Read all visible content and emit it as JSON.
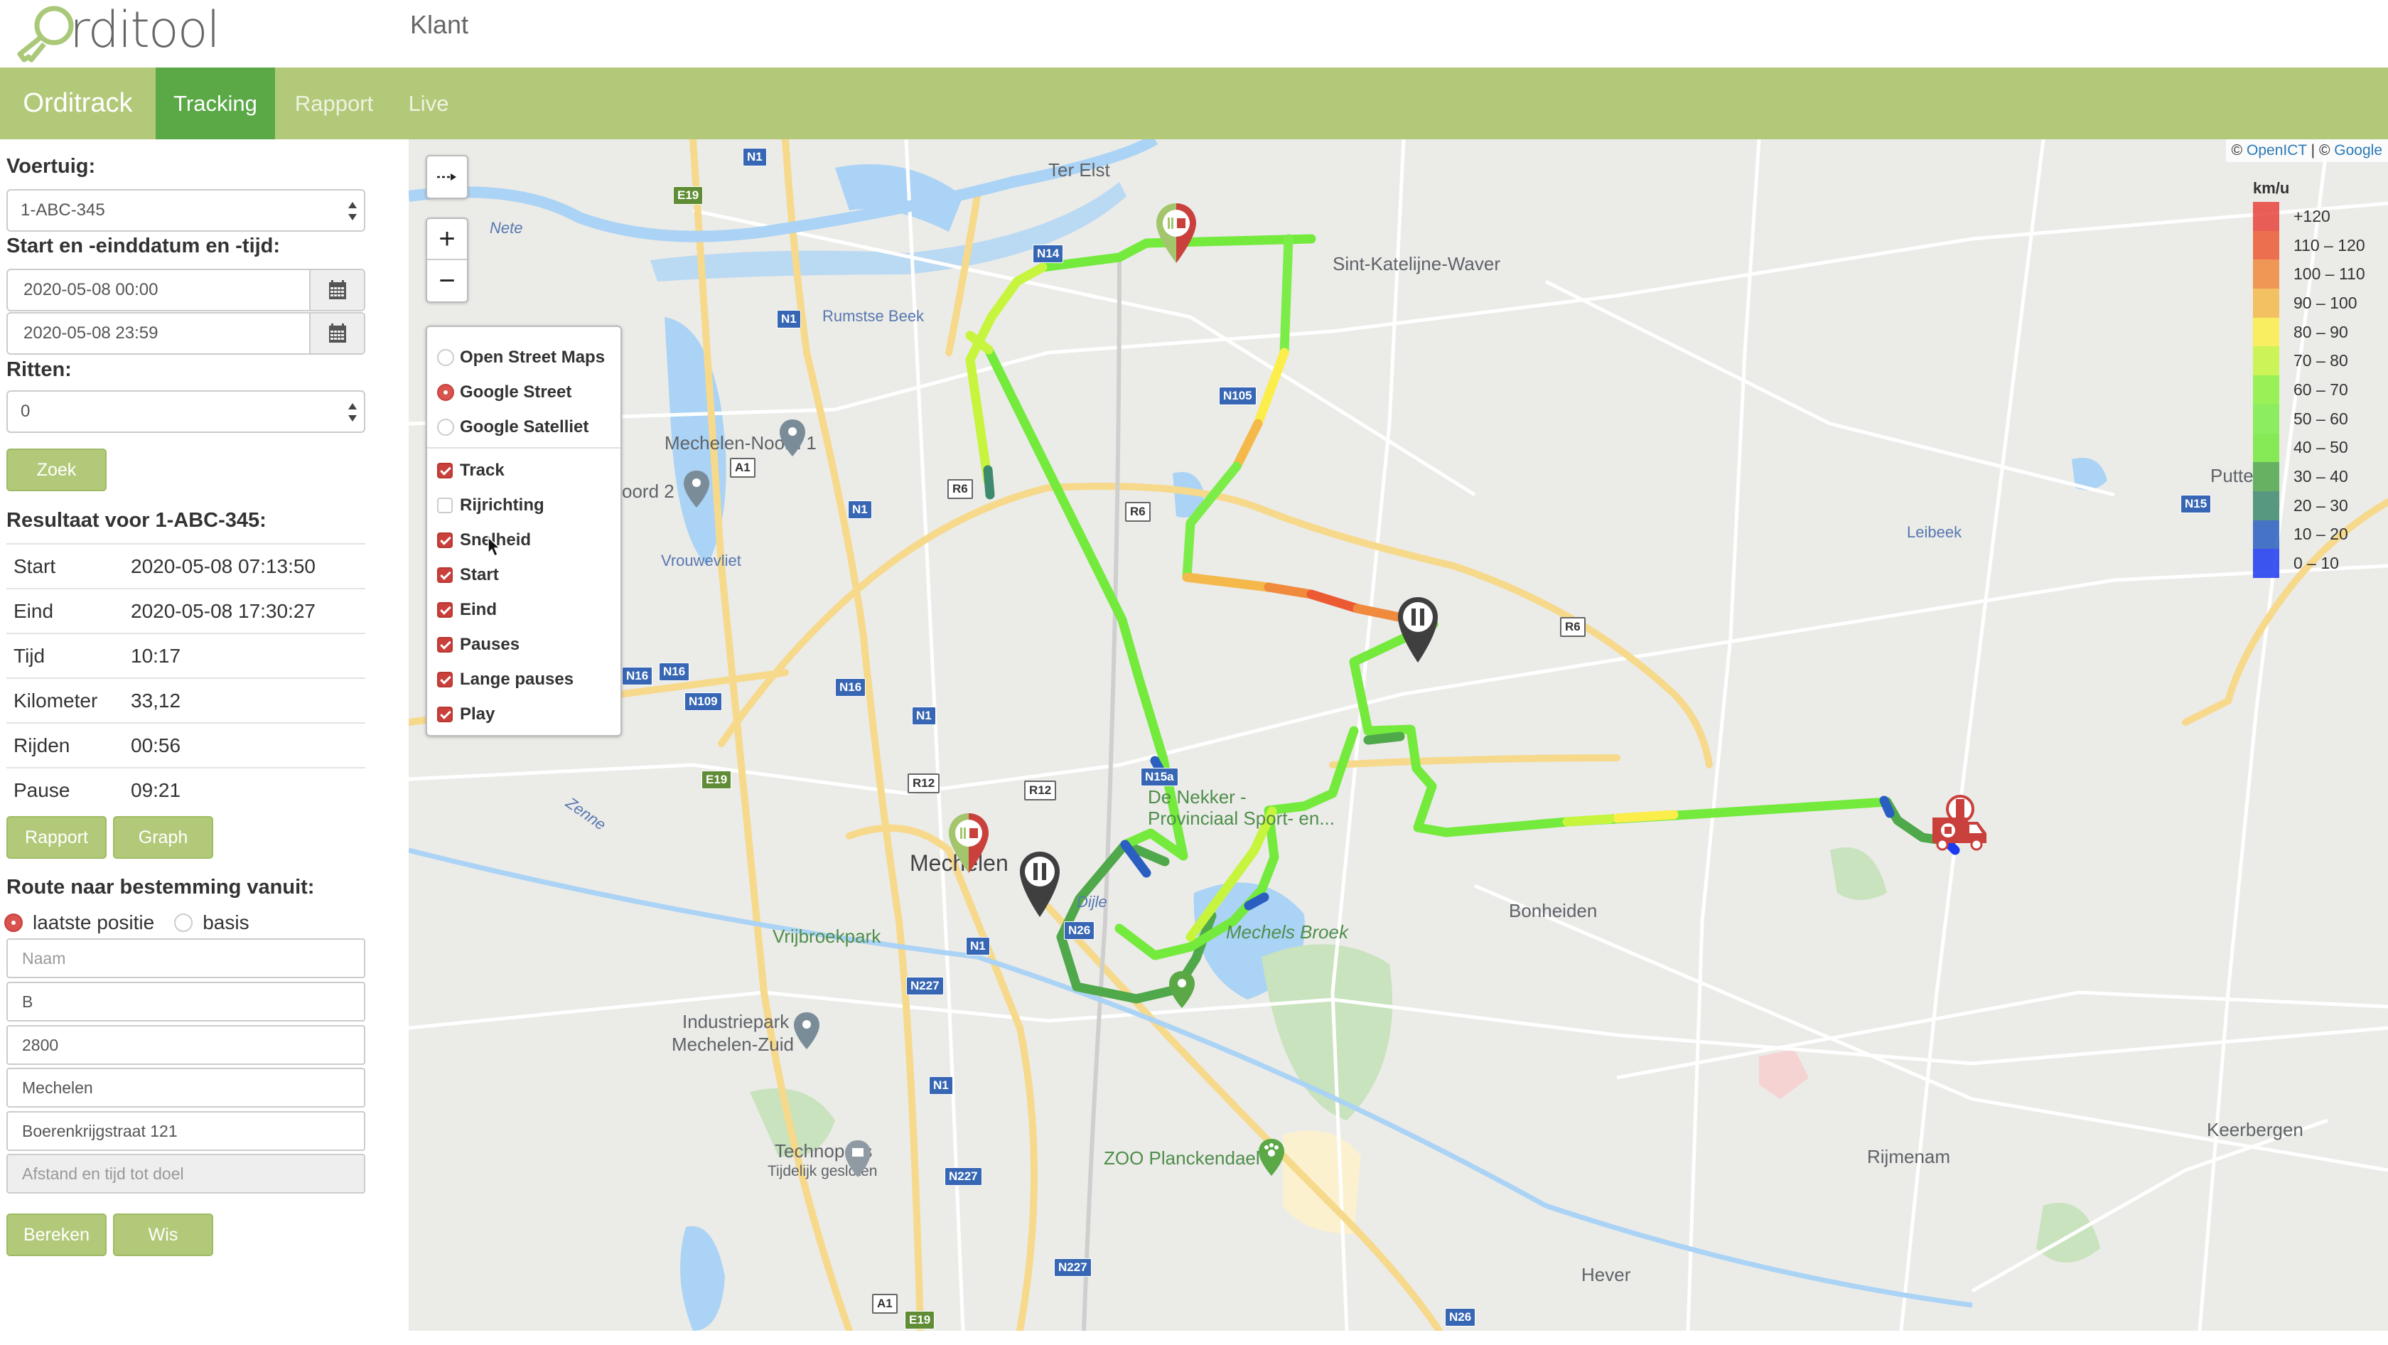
{
  "header": {
    "logo_text": "rditool",
    "client_label": "Klant"
  },
  "nav": {
    "brand": "Orditrack",
    "tabs": [
      {
        "label": "Tracking",
        "active": true
      },
      {
        "label": "Rapport",
        "active": false
      },
      {
        "label": "Live",
        "active": false
      }
    ]
  },
  "sidebar": {
    "vehicle_label": "Voertuig:",
    "vehicle_value": "1-ABC-345",
    "datetime_label": "Start en -einddatum en -tijd:",
    "start_datetime": "2020-05-08 00:00",
    "end_datetime": "2020-05-08 23:59",
    "trips_label": "Ritten:",
    "trips_value": "0",
    "search_button": "Zoek",
    "result_title": "Resultaat voor 1-ABC-345:",
    "results": [
      {
        "key": "Start",
        "value": "2020-05-08 07:13:50"
      },
      {
        "key": "Eind",
        "value": "2020-05-08 17:30:27"
      },
      {
        "key": "Tijd",
        "value": "10:17"
      },
      {
        "key": "Kilometer",
        "value": "33,12"
      },
      {
        "key": "Rijden",
        "value": "00:56"
      },
      {
        "key": "Pause",
        "value": "09:21"
      }
    ],
    "report_button": "Rapport",
    "graph_button": "Graph",
    "route_title": "Route naar bestemming vanuit:",
    "route_options": [
      {
        "label": "laatste positie",
        "selected": true
      },
      {
        "label": "basis",
        "selected": false
      }
    ],
    "name_placeholder": "Naam",
    "country_value": "B",
    "postcode_value": "2800",
    "city_value": "Mechelen",
    "street_value": "Boerenkrijgstraat 121",
    "distance_placeholder": "Afstand en tijd tot doel",
    "calc_button": "Bereken",
    "clear_button": "Wis"
  },
  "map": {
    "attribution_prefix": "©",
    "attribution_openict": "OpenICT",
    "attribution_sep": "| ©",
    "attribution_google": "Google",
    "controls": {
      "toggle_icon": "dashed-arrow-right-icon",
      "zoom_in": "+",
      "zoom_out": "−"
    },
    "base_layers": [
      {
        "label": "Open Street Maps",
        "selected": false
      },
      {
        "label": "Google Street",
        "selected": true
      },
      {
        "label": "Google Satelliet",
        "selected": false
      }
    ],
    "overlays": [
      {
        "label": "Track",
        "checked": true
      },
      {
        "label": "Rijrichting",
        "checked": false
      },
      {
        "label": "Snelheid",
        "checked": true
      },
      {
        "label": "Start",
        "checked": true
      },
      {
        "label": "Eind",
        "checked": true
      },
      {
        "label": "Pauses",
        "checked": true
      },
      {
        "label": "Lange pauses",
        "checked": true
      },
      {
        "label": "Play",
        "checked": true
      }
    ],
    "legend": {
      "title": "km/u",
      "ranges": [
        {
          "label": "+120",
          "color": "#e8453c"
        },
        {
          "label": "110 – 120",
          "color": "#ec5a34"
        },
        {
          "label": "100 – 110",
          "color": "#f08a3c"
        },
        {
          "label": "90 – 100",
          "color": "#f4b94a"
        },
        {
          "label": "80 – 90",
          "color": "#fbee4a"
        },
        {
          "label": "70 – 80",
          "color": "#c7f53e"
        },
        {
          "label": "60 – 70",
          "color": "#8af23c"
        },
        {
          "label": "50 – 60",
          "color": "#7ced48"
        },
        {
          "label": "40 – 50",
          "color": "#74ea3c"
        },
        {
          "label": "30 – 40",
          "color": "#4fa84a"
        },
        {
          "label": "20 – 30",
          "color": "#3d8a6e"
        },
        {
          "label": "10 – 20",
          "color": "#2a5ec0"
        },
        {
          "label": "0 – 10",
          "color": "#1d3af0"
        }
      ]
    },
    "place_labels": [
      {
        "text": "Ter Elst",
        "type": "town"
      },
      {
        "text": "Sint-Katelijne-Waver",
        "type": "town"
      },
      {
        "text": "Rumstse Beek",
        "type": "water"
      },
      {
        "text": "Mechelen-Noord 1",
        "type": "poi"
      },
      {
        "text": "oord 2",
        "type": "poi"
      },
      {
        "text": "Vrouwevliet",
        "type": "water"
      },
      {
        "text": "Leibeek",
        "type": "water"
      },
      {
        "text": "Putte",
        "type": "town"
      },
      {
        "text": "De Nekker -",
        "type": "park"
      },
      {
        "text": "Provinciaal Sport- en...",
        "type": "park"
      },
      {
        "text": "Mechelen",
        "type": "city"
      },
      {
        "text": "Vrijbroekpark",
        "type": "park"
      },
      {
        "text": "Mechels Broek",
        "type": "park"
      },
      {
        "text": "Bonheiden",
        "type": "town"
      },
      {
        "text": "Industriepark",
        "type": "poi"
      },
      {
        "text": "Mechelen-Zuid",
        "type": "poi"
      },
      {
        "text": "Technopolis",
        "type": "poi"
      },
      {
        "text": "Tijdelijk gesloten",
        "type": "poi-sub"
      },
      {
        "text": "ZOO Planckendael",
        "type": "park"
      },
      {
        "text": "Keerbergen",
        "type": "town"
      },
      {
        "text": "Rijmenam",
        "type": "town"
      },
      {
        "text": "Hever",
        "type": "town"
      },
      {
        "text": "Nete",
        "type": "water"
      },
      {
        "text": "Dijle",
        "type": "water"
      },
      {
        "text": "Zenne",
        "type": "water"
      }
    ],
    "road_shields": [
      "N1",
      "E19",
      "N14",
      "N1",
      "A1",
      "N1",
      "R6",
      "R6",
      "N105",
      "N15",
      "R6",
      "N16",
      "N16",
      "N109",
      "N16",
      "N1",
      "E19",
      "R12",
      "R12",
      "N15a",
      "N26",
      "N1",
      "N227",
      "N1",
      "N227",
      "N227",
      "A1",
      "E19",
      "N26"
    ],
    "markers": [
      {
        "type": "start-end",
        "icon": "start-end-pin-icon"
      },
      {
        "type": "start-end",
        "icon": "start-end-pin-icon"
      },
      {
        "type": "pause",
        "icon": "pause-pin-icon"
      },
      {
        "type": "pause",
        "icon": "pause-pin-icon"
      },
      {
        "type": "vehicle",
        "icon": "truck-icon"
      }
    ]
  }
}
